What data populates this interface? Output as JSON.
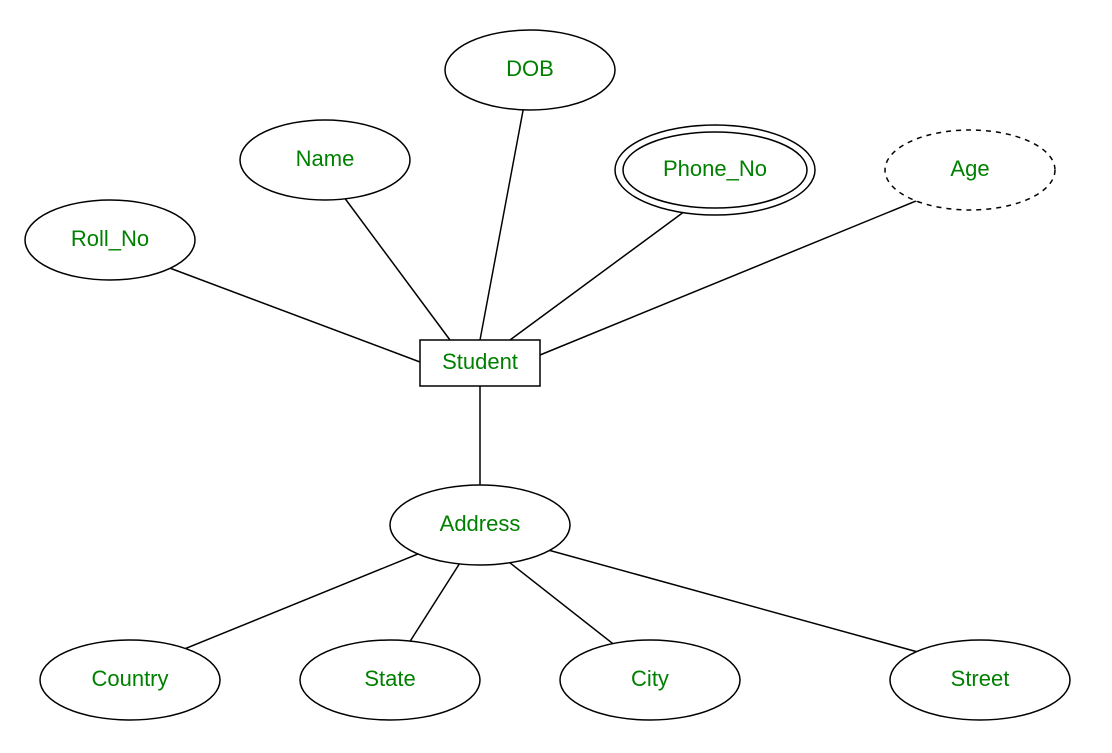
{
  "diagram": {
    "entity": {
      "label": "Student"
    },
    "attributes": {
      "roll_no": {
        "label": "Roll_No"
      },
      "name": {
        "label": "Name"
      },
      "dob": {
        "label": "DOB"
      },
      "phone": {
        "label": "Phone_No"
      },
      "age": {
        "label": "Age"
      },
      "address": {
        "label": "Address"
      },
      "country": {
        "label": "Country"
      },
      "state": {
        "label": "State"
      },
      "city": {
        "label": "City"
      },
      "street": {
        "label": "Street"
      }
    }
  }
}
